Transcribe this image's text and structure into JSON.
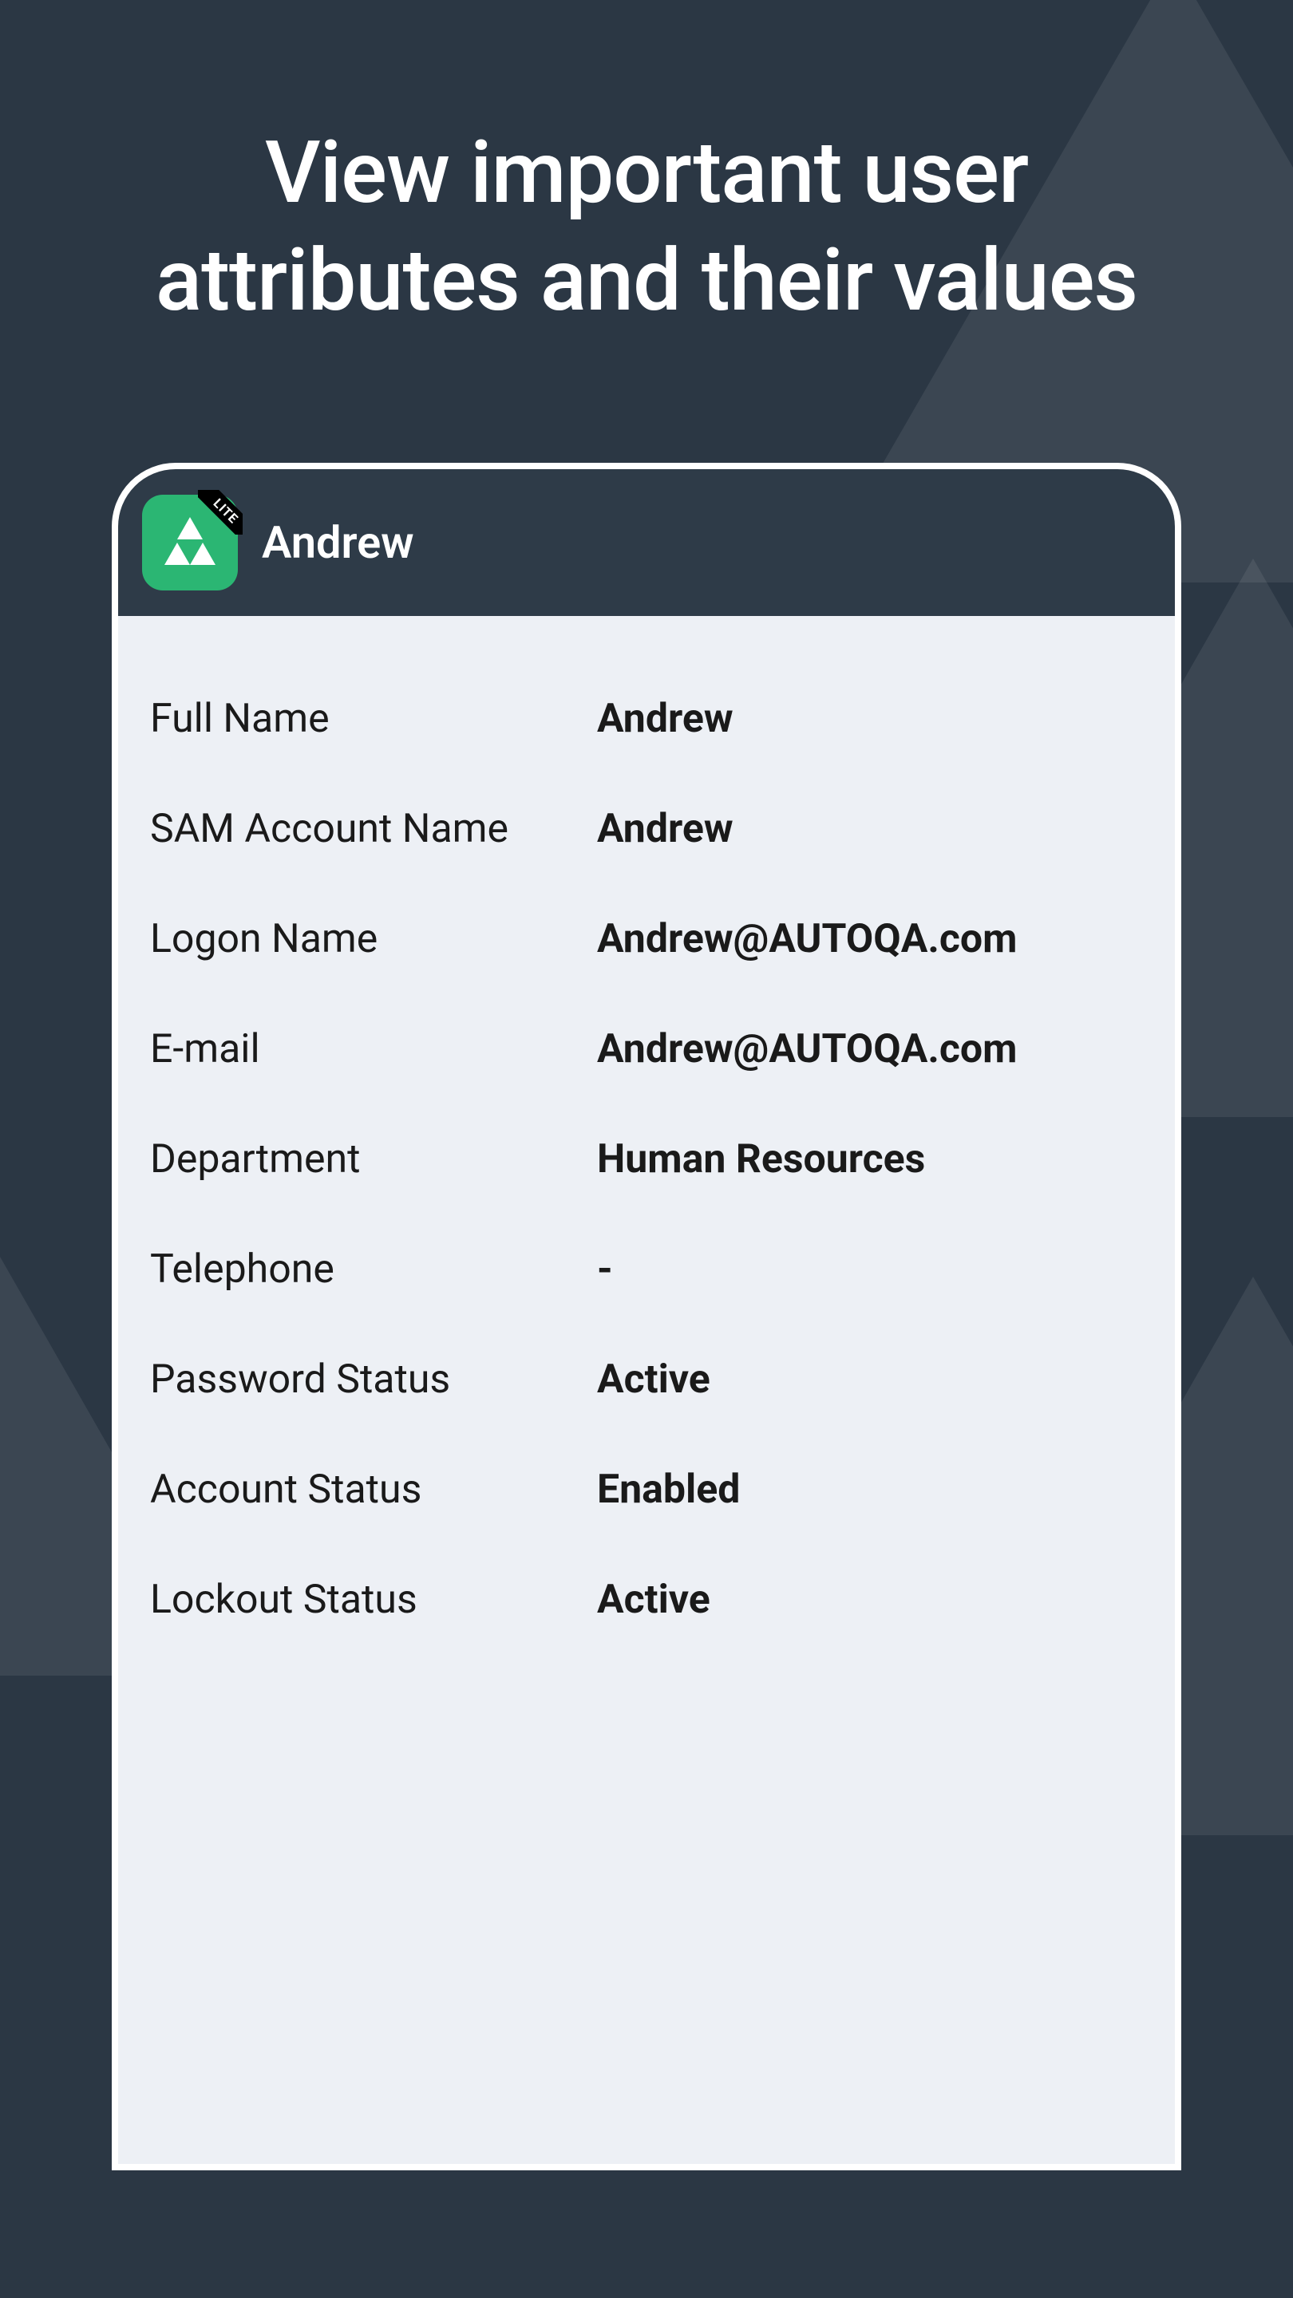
{
  "headline": "View important user attributes and their values",
  "app": {
    "title": "Andrew",
    "lite_badge": "LITE"
  },
  "attributes": [
    {
      "label": "Full Name",
      "value": "Andrew"
    },
    {
      "label": "SAM Account Name",
      "value": "Andrew"
    },
    {
      "label": "Logon Name",
      "value": "Andrew@AUTOQA.com"
    },
    {
      "label": "E-mail",
      "value": "Andrew@AUTOQA.com"
    },
    {
      "label": "Department",
      "value": "Human Resources"
    },
    {
      "label": "Telephone",
      "value": "-"
    },
    {
      "label": "Password Status",
      "value": "Active"
    },
    {
      "label": "Account Status",
      "value": "Enabled"
    },
    {
      "label": "Lockout Status",
      "value": "Active"
    }
  ]
}
